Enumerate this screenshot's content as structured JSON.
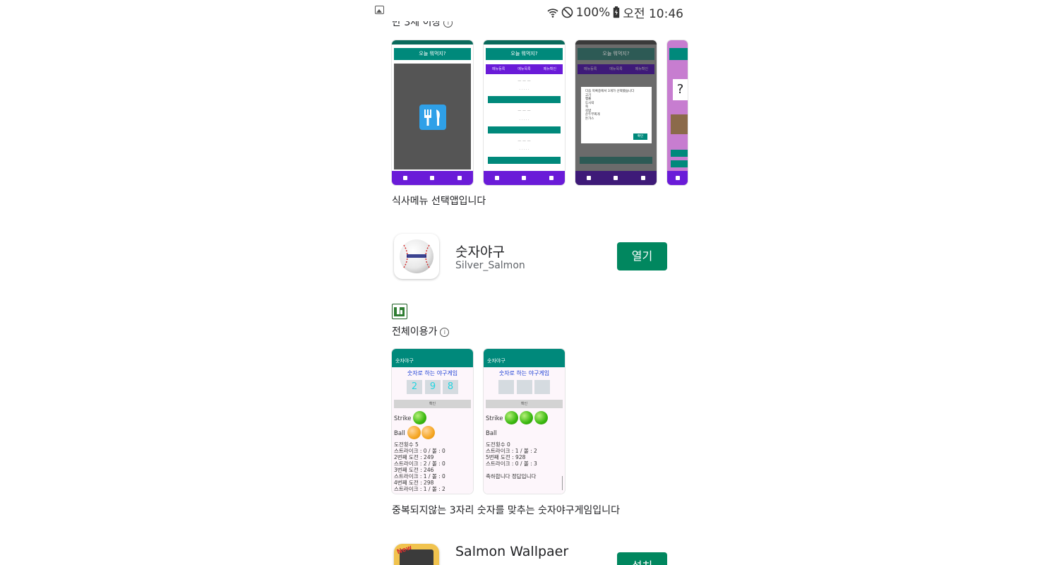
{
  "status_bar": {
    "battery": "100%",
    "time": "오전 10:46"
  },
  "top_section": {
    "rating_label": "만 3세 이상",
    "description": "식사메뉴 선택앱입니다",
    "screens": {
      "header_title": "오늘 뭐먹지?",
      "tabs": [
        "메뉴등록",
        "메뉴목록",
        "메뉴확인"
      ],
      "dialog_title": "다음 목록중에서 3개가 선택됐습니다",
      "dialog_items": [
        "고기",
        "햄롤",
        "도시락",
        "죽",
        "김밥",
        "순두부찌개",
        "돈가스"
      ],
      "dialog_ok": "확인",
      "partial_question": "?"
    }
  },
  "baseball_app": {
    "title": "숫자야구",
    "developer": "Silver_Salmon",
    "action_label": "열기",
    "rating_label": "전체이용가",
    "description": "중복되지않는 3자리 숫자를 맞추는 숫자야구게임입니다",
    "screens": [
      {
        "header": "숫자야구",
        "subtitle": "숫자로 하는 야구게임",
        "digits": [
          "2",
          "9",
          "8"
        ],
        "confirm": "확인",
        "strike_label": "Strike",
        "ball_label": "Ball",
        "strike_count": 1,
        "ball_count": 2,
        "log": [
          "도전횟수 5",
          "스트라이크 : 0 / 볼 : 0",
          "2번째 도전 : 249",
          "스트라이크 : 2 / 볼 : 0",
          "3번째 도전 : 246",
          "스트라이크 : 1 / 볼 : 0",
          "4번째 도전 : 298",
          "스트라이크 : 1 / 볼 : 2"
        ]
      },
      {
        "header": "숫자야구",
        "subtitle": "숫자로 하는 야구게임",
        "digits": [
          "",
          "",
          ""
        ],
        "confirm": "확인",
        "strike_label": "Strike",
        "ball_label": "Ball",
        "strike_count": 3,
        "ball_count": 0,
        "log": [
          "도전횟수 0",
          "스트라이크 : 1 / 볼 : 2",
          "5번째 도전 : 928",
          "스트라이크 : 0 / 볼 : 3",
          "",
          "축하합니다 정답입니다"
        ]
      }
    ]
  },
  "next_app": {
    "title": "Salmon Wallpaer",
    "action_label": "설치",
    "icon_badge": "New"
  },
  "colors": {
    "install_green": "#01875f",
    "teal": "#00897b",
    "purple": "#6a1bd8"
  }
}
